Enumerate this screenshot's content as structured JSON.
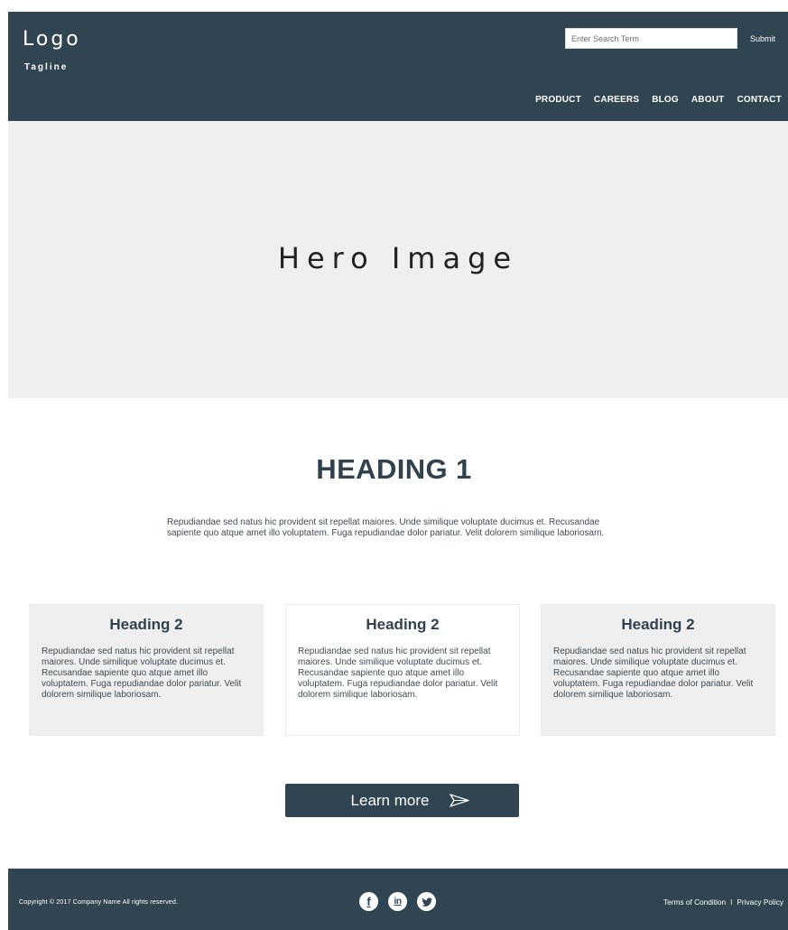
{
  "header": {
    "logo": "Logo",
    "tagline": "Tagline",
    "search": {
      "placeholder": "Enter Search Term",
      "value": "",
      "submit_label": "Submit"
    },
    "nav": [
      {
        "label": "PRODUCT"
      },
      {
        "label": "CAREERS"
      },
      {
        "label": "BLOG"
      },
      {
        "label": "ABOUT"
      },
      {
        "label": "CONTACT"
      }
    ]
  },
  "hero": {
    "text": "Hero Image"
  },
  "main": {
    "heading": "HEADING 1",
    "intro": "Repudiandae sed natus hic provident sit repellat maiores. Unde similique voluptate ducimus et. Recusandae sapiente quo atque amet illo voluptatem. Fuga repudiandae dolor pariatur. Velit dolorem similique laboriosam.",
    "cards": [
      {
        "heading": "Heading 2",
        "text": "Repudiandae sed natus hic provident sit repellat maiores. Unde similique voluptate ducimus et. Recusandae sapiente quo atque amet illo voluptatem. Fuga repudiandae dolor pariatur. Velit dolorem similique laboriosam."
      },
      {
        "heading": "Heading 2",
        "text": "Repudiandae sed natus hic provident sit repellat maiores. Unde similique voluptate ducimus et. Recusandae sapiente quo atque amet illo voluptatem. Fuga repudiandae dolor pariatur. Velit dolorem similique laboriosam."
      },
      {
        "heading": "Heading 2",
        "text": "Repudiandae sed natus hic provident sit repellat maiores. Unde similique voluptate ducimus et. Recusandae sapiente quo atque amet illo voluptatem. Fuga repudiandae dolor pariatur. Velit dolorem similique laboriosam."
      }
    ],
    "cta": {
      "label": "Learn more",
      "icon": "send-icon"
    }
  },
  "footer": {
    "copyright": "Copyright © 2017 Company Name  All rights reserved.",
    "socials": [
      {
        "icon": "facebook-icon",
        "glyph": "f"
      },
      {
        "icon": "linkedin-icon",
        "glyph": "in"
      },
      {
        "icon": "twitter-icon",
        "glyph": ""
      }
    ],
    "links": {
      "terms": "Terms of Condition",
      "separator": "I",
      "privacy": "Privacy Policy"
    }
  },
  "colors": {
    "primary": "#314451",
    "hero_bg": "#efefef",
    "card_grey": "#efefef",
    "text_dark": "#31424f",
    "white": "#ffffff"
  }
}
